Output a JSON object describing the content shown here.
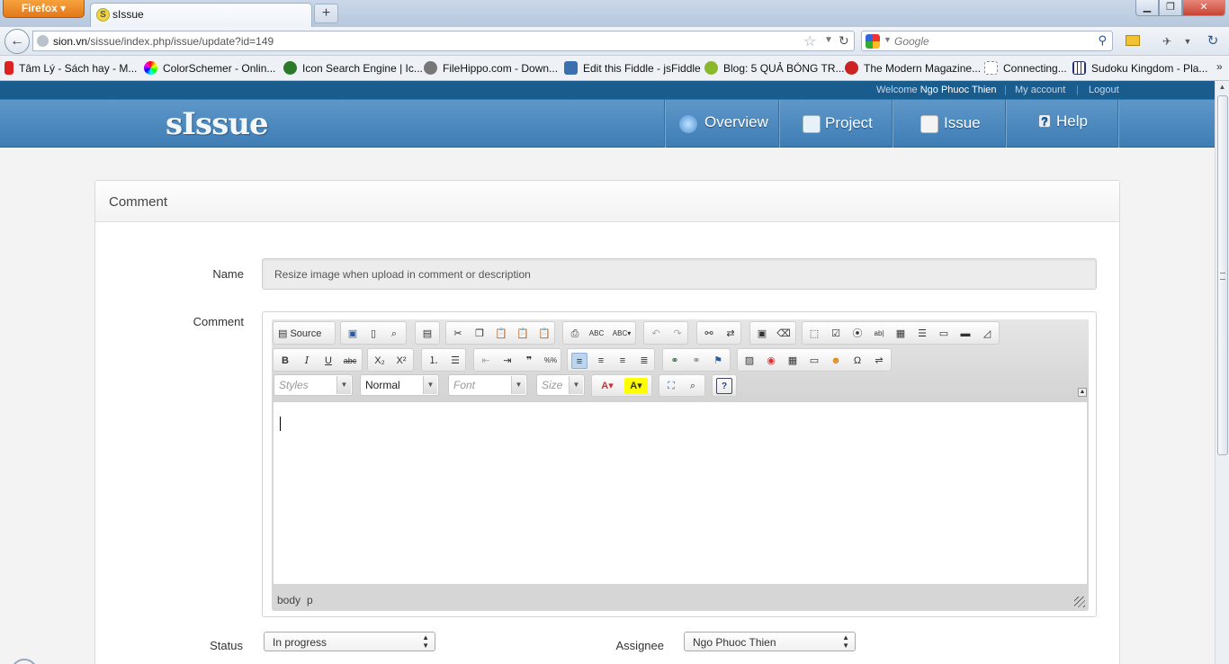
{
  "browser": {
    "app_button": "Firefox",
    "tab_title": "sIssue",
    "tab_favicon_letter": "S",
    "url_host": "sion.vn",
    "url_path": "/sissue/index.php/issue/update?id=149",
    "search_placeholder": "Google",
    "bookmarks": [
      {
        "label": "Tâm Lý - Sách hay - M...",
        "icon": "m-icon",
        "color": "#d22"
      },
      {
        "label": "ColorSchemer - Onlin...",
        "icon": "colorwheel-icon",
        "color": "#e6a"
      },
      {
        "label": "Icon Search Engine | Ic...",
        "icon": "eye-icon",
        "color": "#2a7a2a"
      },
      {
        "label": "FileHippo.com - Down...",
        "icon": "hippo-icon",
        "color": "#555"
      },
      {
        "label": "Edit this Fiddle - jsFiddle",
        "icon": "cloud-icon",
        "color": "#3b6fb0"
      },
      {
        "label": "Blog: 5 QUẢ BÓNG TR...",
        "icon": "blog-icon",
        "color": "#8bb82b"
      },
      {
        "label": "The Modern Magazine...",
        "icon": "apple-icon",
        "color": "#c22"
      },
      {
        "label": "Connecting...",
        "icon": "page-icon",
        "color": "#eee"
      },
      {
        "label": "Sudoku Kingdom - Pla...",
        "icon": "grid-icon",
        "color": "#237"
      }
    ]
  },
  "site": {
    "welcome_prefix": "Welcome",
    "user_name": "Ngo Phuoc Thien",
    "my_account": "My account",
    "logout": "Logout",
    "logo": "sIssue",
    "menu": [
      {
        "label": "Overview",
        "icon": "globe-icon"
      },
      {
        "label": "Project",
        "icon": "project-icon"
      },
      {
        "label": "Issue",
        "icon": "issue-icon"
      },
      {
        "label": "Help",
        "icon": "help-icon"
      }
    ]
  },
  "form": {
    "panel_title": "Comment",
    "name_label": "Name",
    "name_value": "Resize image when upload in comment or description",
    "comment_label": "Comment",
    "editor": {
      "source_label": "Source",
      "styles_placeholder": "Styles",
      "format_value": "Normal",
      "font_placeholder": "Font",
      "size_placeholder": "Size",
      "path": [
        "body",
        "p"
      ]
    },
    "status_label": "Status",
    "status_value": "In progress",
    "assignee_label": "Assignee",
    "assignee_value": "Ngo Phuoc Thien"
  }
}
